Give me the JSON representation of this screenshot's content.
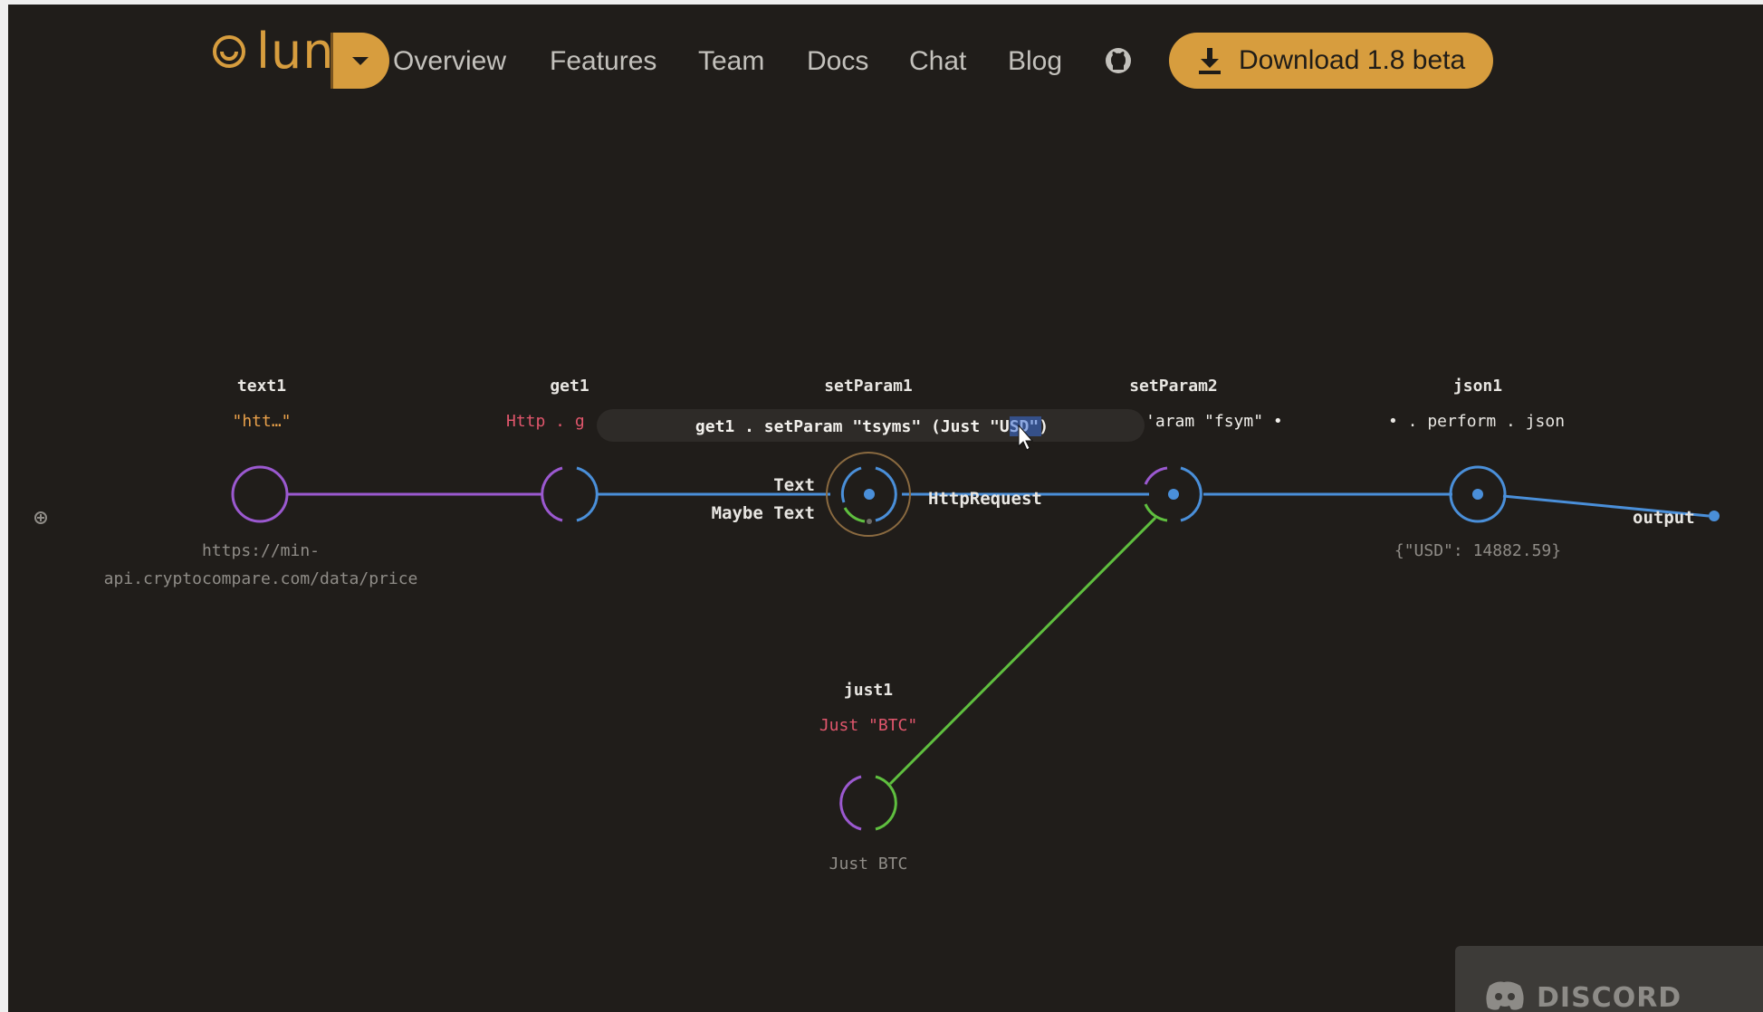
{
  "brand": {
    "logo_text": "luna",
    "accent_color": "#d79d3e"
  },
  "nav": {
    "links": [
      "Overview",
      "Features",
      "Team",
      "Docs",
      "Chat",
      "Blog"
    ],
    "github_icon": "github-icon",
    "download_label": "Download 1.8 beta",
    "download_icon": "download-icon",
    "dropdown_icon": "caret-down-icon"
  },
  "graph": {
    "nodes": [
      {
        "id": "text1",
        "title": "text1",
        "expression": "\"htt…\"",
        "value_lines": [
          "https://min-",
          "api.cryptocompare.com/data/price"
        ]
      },
      {
        "id": "get1",
        "title": "get1",
        "expression": "Http . g"
      },
      {
        "id": "setParam1",
        "title": "setParam1",
        "expression_editor": "get1 . setParam \"tsyms\" (Just \"USD\")",
        "in_ports": [
          "Text",
          "Maybe Text"
        ],
        "out_port": "HttpRequest"
      },
      {
        "id": "setParam2",
        "title": "setParam2",
        "expression": "'aram \"fsym\" •"
      },
      {
        "id": "json1",
        "title": "json1",
        "expression": "• . perform . json",
        "value_lines": [
          "{\"USD\": 14882.59}"
        ]
      },
      {
        "id": "just1",
        "title": "just1",
        "expression": "Just \"BTC\"",
        "value_lines": [
          "Just BTC"
        ]
      }
    ],
    "output_label": "output",
    "colors": {
      "text": "#9b59d0",
      "http": "#4a8fd9",
      "maybe": "#5fbf3f",
      "code_red": "#e0566c",
      "code_orange": "#e8a04a"
    }
  },
  "discord": {
    "label": "DISCORD",
    "icon": "discord-icon"
  }
}
